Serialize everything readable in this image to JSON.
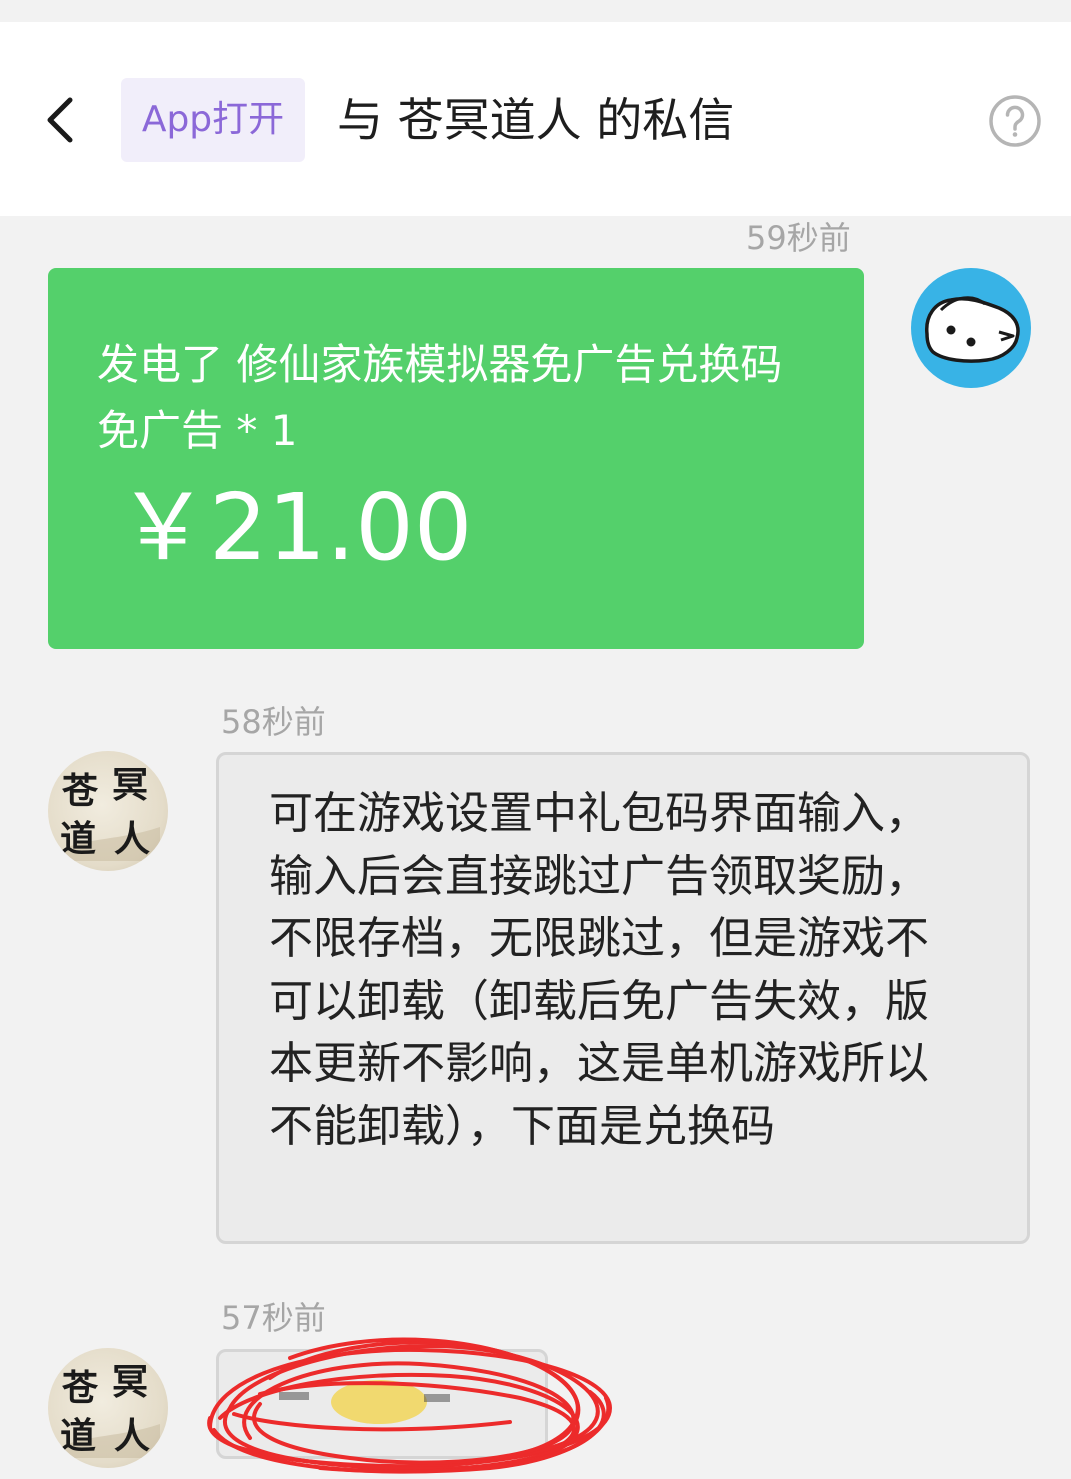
{
  "header": {
    "app_open_label": "App打开",
    "title": "与 苍冥道人 的私信",
    "icons": {
      "back": "chevron-left-icon",
      "help": "question-circle-icon"
    }
  },
  "messages": [
    {
      "timestamp": "59秒前",
      "sender": "self",
      "type": "power-card",
      "title": "发电了 修仙家族模拟器免广告兑换码",
      "item": "免广告 * 1",
      "amount": "￥21.00",
      "color": "#54d06b"
    },
    {
      "timestamp": "58秒前",
      "sender": "苍冥道人",
      "type": "text",
      "text": "可在游戏设置中礼包码界面输入，输入后会直接跳过广告领取奖励，不限存档，无限跳过，但是游戏不可以卸载（卸载后免广告失效，版本更新不影响，这是单机游戏所以不能卸载），下面是兑换码"
    },
    {
      "timestamp": "57秒前",
      "sender": "苍冥道人",
      "type": "redacted-code"
    }
  ],
  "avatars": {
    "other_name": "苍冥道人",
    "other_chars": [
      "苍",
      "冥",
      "道",
      "人"
    ],
    "self_color": "#38b3e6"
  }
}
